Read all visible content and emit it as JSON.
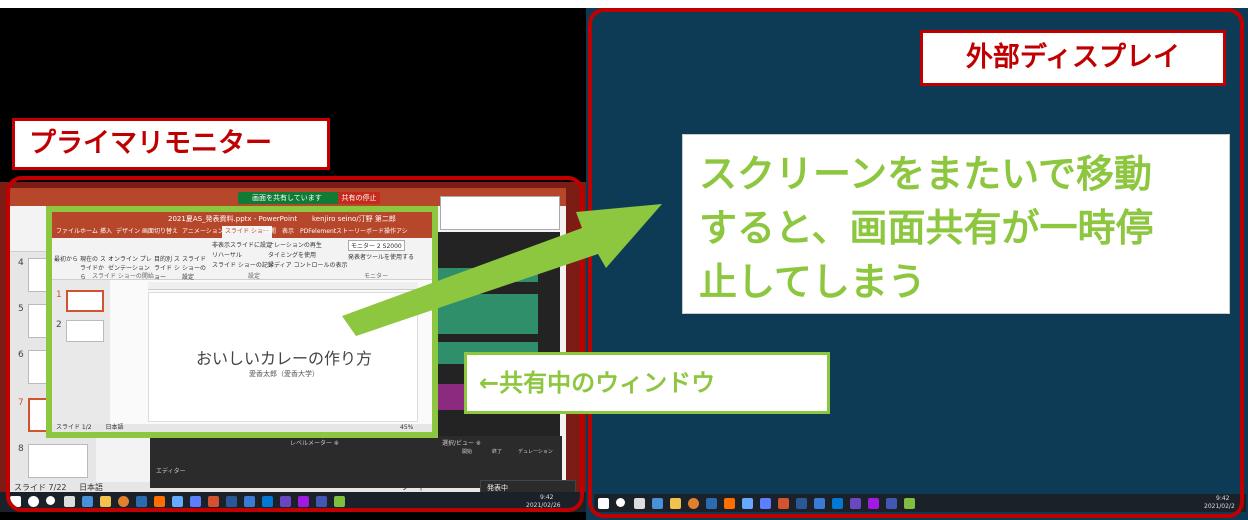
{
  "labels": {
    "primary_monitor": "プライマリモニター",
    "external_display": "外部ディスプレイ",
    "shared_window": "←共有中のウィンドウ",
    "callout_lines": [
      "スクリーンをまたいで移動",
      "すると、画面共有が一時停",
      "止してしまう"
    ]
  },
  "share_bar": {
    "status": "画面を共有しています",
    "stop": "共有の停止"
  },
  "powerpoint": {
    "window_title": "2021夏AS_発表資料.pptx - PowerPoint",
    "user": "kenjiro seino/汀野 第二郎",
    "tabs": [
      "ファイル",
      "ホーム",
      "挿入",
      "デザイン",
      "画面切り替え",
      "アニメーション",
      "スライド ショー",
      "校閲",
      "表示",
      "PDFelement",
      "ストーリーボード"
    ],
    "active_tab": "スライド ショー",
    "tell_me": "操作アシ",
    "ribbon": {
      "from_beginning": "最初から",
      "from_current": "現在の スライドから",
      "online": "オンライン プレゼンテーション",
      "custom": "目的別 スライド ショー",
      "setup": "スライド ショーの設定",
      "hide": "非表示スライドに設定",
      "rehearse": "リハーサル",
      "record": "スライド ショーの記録",
      "play_narration": "ナレーションの再生",
      "use_timings": "タイミングを使用",
      "show_media": "メディア コントロールの表示",
      "monitor": "モニター 2 S2000",
      "presenter_view": "発表者ツールを使用する",
      "group_start": "スライド ショーの開始",
      "group_setup": "設定",
      "group_monitor": "モニター"
    },
    "slide_title": "おいしいカレーの作り方",
    "slide_subtitle": "愛香太郎（愛香大学）",
    "status": "スライド 1/2",
    "language": "日本語",
    "zoom": "45%",
    "bg_status": "スライド 7/22",
    "bg_language": "日本語",
    "bg_notes": "ノート",
    "thumb_numbers": [
      "4",
      "5",
      "6",
      "7",
      "8"
    ],
    "shared_thumb_numbers": [
      "1",
      "2"
    ]
  },
  "audio": {
    "panel_title": "選択/ビュー ※",
    "levels": "レベルメーター ※",
    "edit_tab": "エディター",
    "start": "開始",
    "end": "終了",
    "duration": "デュレーション"
  },
  "popup": "発表中",
  "taskbar": {
    "time_left": "9:42",
    "date_left": "2021/02/26",
    "time_right": "9:42",
    "date_right": "2021/02/2"
  },
  "taskbar_icon_colors": [
    "#ffffff",
    "#ffffff",
    "#4a90d9",
    "#f2c14e",
    "#e0812f",
    "#2b6cb0",
    "#ff6f00",
    "#66aaff",
    "#d35230",
    "#2b5797",
    "#3a7bd5",
    "#0078d4",
    "#6b46c1",
    "#9f1ae2",
    "#4257b2",
    "#7fbf3f"
  ]
}
